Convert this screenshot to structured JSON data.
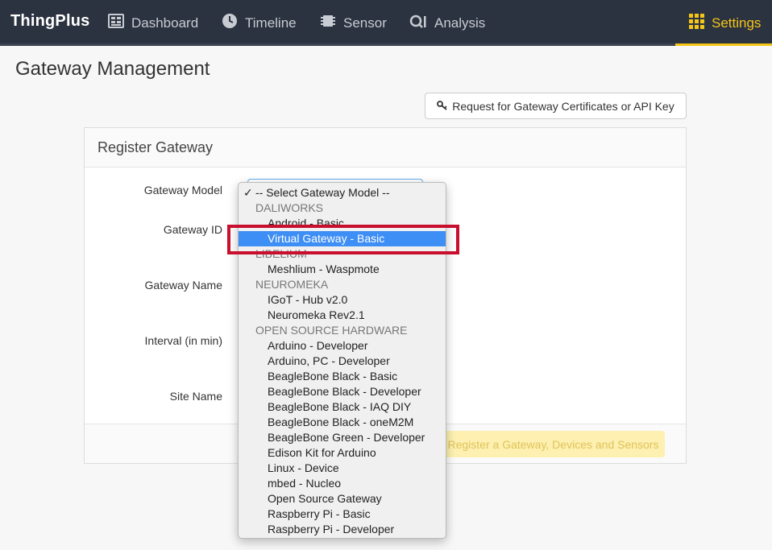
{
  "app": {
    "brand": "ThingPlus"
  },
  "nav": {
    "items": [
      {
        "label": "Dashboard",
        "icon": "dashboard-icon"
      },
      {
        "label": "Timeline",
        "icon": "clock-icon"
      },
      {
        "label": "Sensor",
        "icon": "chip-icon"
      },
      {
        "label": "Analysis",
        "icon": "analysis-icon"
      }
    ],
    "settings": {
      "label": "Settings",
      "icon": "grid-icon",
      "color": "#f5c518"
    }
  },
  "page": {
    "title": "Gateway Management"
  },
  "cert_button": {
    "label": "Request for Gateway Certificates or API Key",
    "icon": "key-icon"
  },
  "panel": {
    "title": "Register Gateway",
    "labels": {
      "model": "Gateway Model",
      "id": "Gateway ID",
      "name": "Gateway Name",
      "interval": "Interval (in min)",
      "site": "Site Name"
    },
    "register_button": "Register a Gateway, Devices and Sensors"
  },
  "dropdown": {
    "check": "✓",
    "options": [
      {
        "label": "-- Select Gateway Model --",
        "kind": "first"
      },
      {
        "label": "DALIWORKS",
        "kind": "group"
      },
      {
        "label": "Android - Basic",
        "kind": "option"
      },
      {
        "label": "Virtual Gateway - Basic",
        "kind": "selected"
      },
      {
        "label": "LIBELIUM",
        "kind": "group"
      },
      {
        "label": "Meshlium - Waspmote",
        "kind": "option"
      },
      {
        "label": "NEUROMEKA",
        "kind": "group"
      },
      {
        "label": "IGoT - Hub v2.0",
        "kind": "option"
      },
      {
        "label": "Neuromeka Rev2.1",
        "kind": "option"
      },
      {
        "label": "OPEN SOURCE HARDWARE",
        "kind": "group"
      },
      {
        "label": "Arduino - Developer",
        "kind": "option"
      },
      {
        "label": "Arduino, PC - Developer",
        "kind": "option"
      },
      {
        "label": "BeagleBone Black - Basic",
        "kind": "option"
      },
      {
        "label": "BeagleBone Black - Developer",
        "kind": "option"
      },
      {
        "label": "BeagleBone Black - IAQ DIY",
        "kind": "option"
      },
      {
        "label": "BeagleBone Black - oneM2M",
        "kind": "option"
      },
      {
        "label": "BeagleBone Green - Developer",
        "kind": "option"
      },
      {
        "label": "Edison Kit for Arduino",
        "kind": "option"
      },
      {
        "label": "Linux - Device",
        "kind": "option"
      },
      {
        "label": "mbed - Nucleo",
        "kind": "option"
      },
      {
        "label": "Open Source Gateway",
        "kind": "option"
      },
      {
        "label": "Raspberry Pi - Basic",
        "kind": "option"
      },
      {
        "label": "Raspberry Pi - Developer",
        "kind": "option"
      }
    ]
  },
  "colors": {
    "navbar": "#2b3340",
    "accent": "#f5c518",
    "selection": "#3d8ef5",
    "highlight": "#c8102e"
  }
}
